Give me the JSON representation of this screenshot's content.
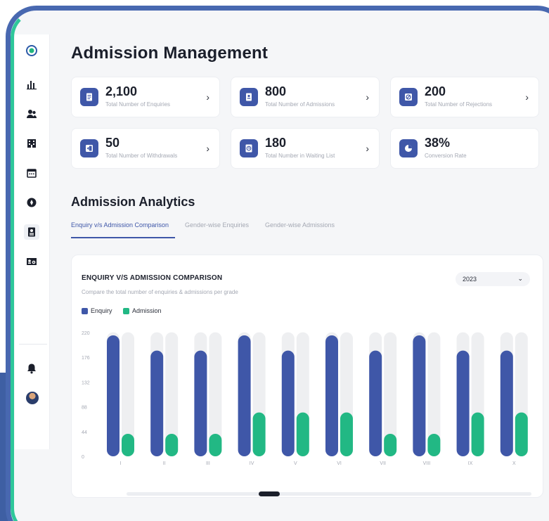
{
  "title": "Admission Management",
  "sidebar": {
    "icons": [
      "logo-icon",
      "chart-icon",
      "users-icon",
      "building-icon",
      "calendar-icon",
      "compass-icon",
      "id-card-icon",
      "id-badge-icon"
    ],
    "bottom_icons": [
      "bell-icon",
      "avatar"
    ]
  },
  "stats": [
    {
      "value": "2,100",
      "label": "Total Number of Enquiries",
      "icon": "document-icon"
    },
    {
      "value": "800",
      "label": "Total Number of Admissions",
      "icon": "id-card-icon"
    },
    {
      "value": "200",
      "label": "Total Number of Rejections",
      "icon": "block-icon"
    },
    {
      "value": "50",
      "label": "Total Number of Withdrawals",
      "icon": "exit-icon"
    },
    {
      "value": "180",
      "label": "Total Number in Waiting List",
      "icon": "clock-doc-icon"
    },
    {
      "value": "38%",
      "label": "Conversion Rate",
      "icon": "pie-icon"
    }
  ],
  "analytics": {
    "title": "Admission Analytics",
    "tabs": [
      "Enquiry v/s Admission Comparison",
      "Gender-wise Enquiries",
      "Gender-wise Admissions"
    ],
    "active_tab": 0
  },
  "chart_card": {
    "title": "ENQUIRY V/S ADMISSION COMPARISON",
    "subtitle": "Compare the total number of enquiries & admissions per grade",
    "year": "2023"
  },
  "colors": {
    "enquiry": "#3f57a8",
    "admission": "#22b884",
    "track": "#eeeff1",
    "accent": "#3f57a8"
  },
  "chart_data": {
    "type": "bar",
    "categories": [
      "I",
      "II",
      "III",
      "IV",
      "V",
      "VI",
      "VII",
      "VIII",
      "IX",
      "X"
    ],
    "series": [
      {
        "name": "Enquiry",
        "values": [
          215,
          188,
          188,
          215,
          188,
          215,
          188,
          215,
          188,
          188
        ]
      },
      {
        "name": "Admission",
        "values": [
          40,
          40,
          40,
          78,
          78,
          78,
          40,
          40,
          78,
          78
        ]
      }
    ],
    "yticks": [
      "0",
      "44",
      "88",
      "132",
      "176",
      "220"
    ],
    "ylim": [
      0,
      220
    ],
    "legend": "top-left",
    "grid": false
  }
}
